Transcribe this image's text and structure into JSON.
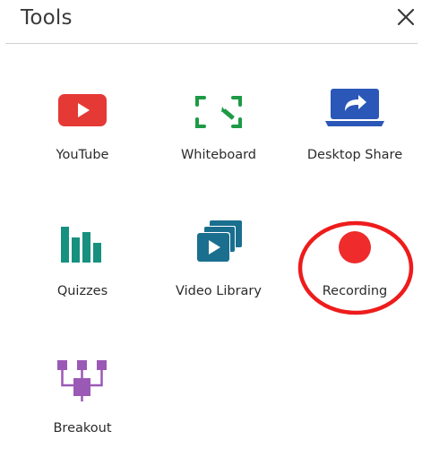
{
  "panel": {
    "title": "Tools",
    "close_symbol": "✕"
  },
  "tools": [
    {
      "label": "YouTube",
      "icon": "youtube-icon",
      "color": "#e53935"
    },
    {
      "label": "Whiteboard",
      "icon": "whiteboard-icon",
      "color": "#1e9a46"
    },
    {
      "label": "Desktop Share",
      "icon": "desktop-share-icon",
      "color": "#2b57b8"
    },
    {
      "label": "Quizzes",
      "icon": "quizzes-icon",
      "color": "#17907f"
    },
    {
      "label": "Video Library",
      "icon": "video-library-icon",
      "color": "#1a6f8f"
    },
    {
      "label": "Recording",
      "icon": "record-icon",
      "color": "#ef2b2b"
    },
    {
      "label": "Breakout",
      "icon": "breakout-icon",
      "color": "#9b59b6"
    }
  ],
  "annotation": {
    "highlight_color": "#ee1c1c",
    "highlighted_tool": "Recording"
  }
}
